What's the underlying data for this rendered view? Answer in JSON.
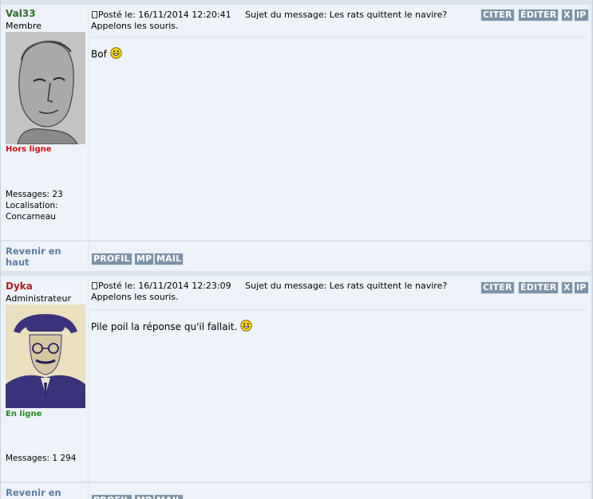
{
  "posts": [
    {
      "author": "Val33",
      "author_color": "#2b6e2b",
      "rank": "Membre",
      "status": "Hors ligne",
      "status_color": "#d01010",
      "stats": [
        "Messages: 23",
        "Localisation:",
        "Concarneau"
      ],
      "posted_label": "Posté le: 16/11/2014 12:20:41",
      "subject_label": "Sujet du message: Les rats quittent le navire?",
      "subject_cont": "Appelons les souris.",
      "body": "Bof",
      "avatar_icon": "sketch-portrait"
    },
    {
      "author": "Dyka",
      "author_color": "#b02020",
      "rank": "Administrateur",
      "status": "En ligne",
      "status_color": "#1e8a1e",
      "stats": [
        "Messages: 1 294"
      ],
      "posted_label": "Posté le: 16/11/2014 12:23:09",
      "subject_label": "Sujet du message: Les rats quittent le navire?",
      "subject_cont": "Appelons les souris.",
      "body": "Pile poil la réponse qu'il fallait.",
      "avatar_icon": "hat-portrait"
    }
  ],
  "actions": {
    "quote": "CITER",
    "edit": "ÉDITER",
    "delete": "X",
    "ip": "IP"
  },
  "footer": {
    "back_top": "Revenir en haut",
    "profile": "PROFIL",
    "pm": "MP",
    "mail": "MAIL"
  }
}
